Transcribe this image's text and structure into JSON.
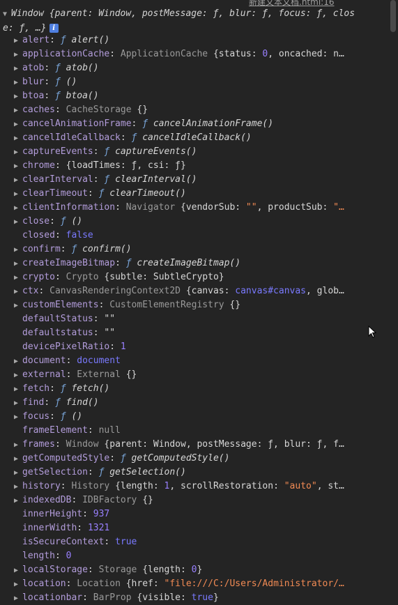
{
  "source_link": "新建文本文档.html:16",
  "root": {
    "text": "Window {parent: Window, postMessage: ƒ, blur: ƒ, focus: ƒ, close: ƒ, …}",
    "info_icon": "i"
  },
  "props": [
    {
      "expand": true,
      "key": "alert",
      "parts": [
        [
          "f",
          "ƒ "
        ],
        [
          "fn",
          "alert()"
        ]
      ]
    },
    {
      "expand": true,
      "key": "applicationCache",
      "parts": [
        [
          "cls",
          "ApplicationCache "
        ],
        [
          "obj",
          "{status: "
        ],
        [
          "num",
          "0"
        ],
        [
          "obj",
          ", oncached: n…"
        ]
      ]
    },
    {
      "expand": true,
      "key": "atob",
      "parts": [
        [
          "f",
          "ƒ "
        ],
        [
          "fn",
          "atob()"
        ]
      ]
    },
    {
      "expand": true,
      "key": "blur",
      "parts": [
        [
          "f",
          "ƒ "
        ],
        [
          "fn",
          "()"
        ]
      ]
    },
    {
      "expand": true,
      "key": "btoa",
      "parts": [
        [
          "f",
          "ƒ "
        ],
        [
          "fn",
          "btoa()"
        ]
      ]
    },
    {
      "expand": true,
      "key": "caches",
      "parts": [
        [
          "cls",
          "CacheStorage "
        ],
        [
          "obj",
          "{}"
        ]
      ]
    },
    {
      "expand": true,
      "key": "cancelAnimationFrame",
      "parts": [
        [
          "f",
          "ƒ "
        ],
        [
          "fn",
          "cancelAnimationFrame()"
        ]
      ]
    },
    {
      "expand": true,
      "key": "cancelIdleCallback",
      "parts": [
        [
          "f",
          "ƒ "
        ],
        [
          "fn",
          "cancelIdleCallback()"
        ]
      ]
    },
    {
      "expand": true,
      "key": "captureEvents",
      "parts": [
        [
          "f",
          "ƒ "
        ],
        [
          "fn",
          "captureEvents()"
        ]
      ]
    },
    {
      "expand": true,
      "key": "chrome",
      "parts": [
        [
          "obj",
          "{loadTimes: ƒ, csi: ƒ}"
        ]
      ]
    },
    {
      "expand": true,
      "key": "clearInterval",
      "parts": [
        [
          "f",
          "ƒ "
        ],
        [
          "fn",
          "clearInterval()"
        ]
      ]
    },
    {
      "expand": true,
      "key": "clearTimeout",
      "parts": [
        [
          "f",
          "ƒ "
        ],
        [
          "fn",
          "clearTimeout()"
        ]
      ]
    },
    {
      "expand": true,
      "key": "clientInformation",
      "parts": [
        [
          "cls",
          "Navigator "
        ],
        [
          "obj",
          "{vendorSub: "
        ],
        [
          "str",
          "\"\""
        ],
        [
          "obj",
          ", productSub: "
        ],
        [
          "str",
          "\"…"
        ]
      ]
    },
    {
      "expand": true,
      "key": "close",
      "parts": [
        [
          "f",
          "ƒ "
        ],
        [
          "fn",
          "()"
        ]
      ]
    },
    {
      "expand": false,
      "key": "closed",
      "parts": [
        [
          "kw",
          "false"
        ]
      ]
    },
    {
      "expand": true,
      "key": "confirm",
      "parts": [
        [
          "f",
          "ƒ "
        ],
        [
          "fn",
          "confirm()"
        ]
      ]
    },
    {
      "expand": true,
      "key": "createImageBitmap",
      "parts": [
        [
          "f",
          "ƒ "
        ],
        [
          "fn",
          "createImageBitmap()"
        ]
      ]
    },
    {
      "expand": true,
      "key": "crypto",
      "parts": [
        [
          "cls",
          "Crypto "
        ],
        [
          "obj",
          "{subtle: SubtleCrypto}"
        ]
      ]
    },
    {
      "expand": true,
      "key": "ctx",
      "parts": [
        [
          "cls",
          "CanvasRenderingContext2D "
        ],
        [
          "obj",
          "{canvas: "
        ],
        [
          "kw",
          "canvas#canvas"
        ],
        [
          "obj",
          ", glob…"
        ]
      ]
    },
    {
      "expand": true,
      "key": "customElements",
      "parts": [
        [
          "cls",
          "CustomElementRegistry "
        ],
        [
          "obj",
          "{}"
        ]
      ]
    },
    {
      "expand": false,
      "key": "defaultStatus",
      "parts": [
        [
          "obj",
          "\"\""
        ]
      ]
    },
    {
      "expand": false,
      "key": "defaultstatus",
      "parts": [
        [
          "obj",
          "\"\""
        ]
      ]
    },
    {
      "expand": false,
      "key": "devicePixelRatio",
      "parts": [
        [
          "num",
          "1"
        ]
      ]
    },
    {
      "expand": true,
      "key": "document",
      "parts": [
        [
          "kw",
          "document"
        ]
      ]
    },
    {
      "expand": true,
      "key": "external",
      "parts": [
        [
          "cls",
          "External "
        ],
        [
          "obj",
          "{}"
        ]
      ]
    },
    {
      "expand": true,
      "key": "fetch",
      "parts": [
        [
          "f",
          "ƒ "
        ],
        [
          "fn",
          "fetch()"
        ]
      ]
    },
    {
      "expand": true,
      "key": "find",
      "parts": [
        [
          "f",
          "ƒ "
        ],
        [
          "fn",
          "find()"
        ]
      ]
    },
    {
      "expand": true,
      "key": "focus",
      "parts": [
        [
          "f",
          "ƒ "
        ],
        [
          "fn",
          "()"
        ]
      ]
    },
    {
      "expand": false,
      "key": "frameElement",
      "parts": [
        [
          "cls",
          "null"
        ]
      ]
    },
    {
      "expand": true,
      "key": "frames",
      "parts": [
        [
          "cls",
          "Window "
        ],
        [
          "obj",
          "{parent: Window, postMessage: ƒ, blur: ƒ, f…"
        ]
      ]
    },
    {
      "expand": true,
      "key": "getComputedStyle",
      "parts": [
        [
          "f",
          "ƒ "
        ],
        [
          "fn",
          "getComputedStyle()"
        ]
      ]
    },
    {
      "expand": true,
      "key": "getSelection",
      "parts": [
        [
          "f",
          "ƒ "
        ],
        [
          "fn",
          "getSelection()"
        ]
      ]
    },
    {
      "expand": true,
      "key": "history",
      "parts": [
        [
          "cls",
          "History "
        ],
        [
          "obj",
          "{length: "
        ],
        [
          "num",
          "1"
        ],
        [
          "obj",
          ", scrollRestoration: "
        ],
        [
          "str",
          "\"auto\""
        ],
        [
          "obj",
          ", st…"
        ]
      ]
    },
    {
      "expand": true,
      "key": "indexedDB",
      "parts": [
        [
          "cls",
          "IDBFactory "
        ],
        [
          "obj",
          "{}"
        ]
      ]
    },
    {
      "expand": false,
      "key": "innerHeight",
      "parts": [
        [
          "num",
          "937"
        ]
      ]
    },
    {
      "expand": false,
      "key": "innerWidth",
      "parts": [
        [
          "num",
          "1321"
        ]
      ]
    },
    {
      "expand": false,
      "key": "isSecureContext",
      "parts": [
        [
          "kw",
          "true"
        ]
      ]
    },
    {
      "expand": false,
      "key": "length",
      "parts": [
        [
          "num",
          "0"
        ]
      ]
    },
    {
      "expand": true,
      "key": "localStorage",
      "parts": [
        [
          "cls",
          "Storage "
        ],
        [
          "obj",
          "{length: "
        ],
        [
          "num",
          "0"
        ],
        [
          "obj",
          "}"
        ]
      ]
    },
    {
      "expand": true,
      "key": "location",
      "parts": [
        [
          "cls",
          "Location "
        ],
        [
          "obj",
          "{href: "
        ],
        [
          "str",
          "\"file:///C:/Users/Administrator/…"
        ]
      ]
    },
    {
      "expand": true,
      "key": "locationbar",
      "parts": [
        [
          "cls",
          "BarProp "
        ],
        [
          "obj",
          "{visible: "
        ],
        [
          "kw",
          "true"
        ],
        [
          "obj",
          "}"
        ]
      ]
    }
  ]
}
